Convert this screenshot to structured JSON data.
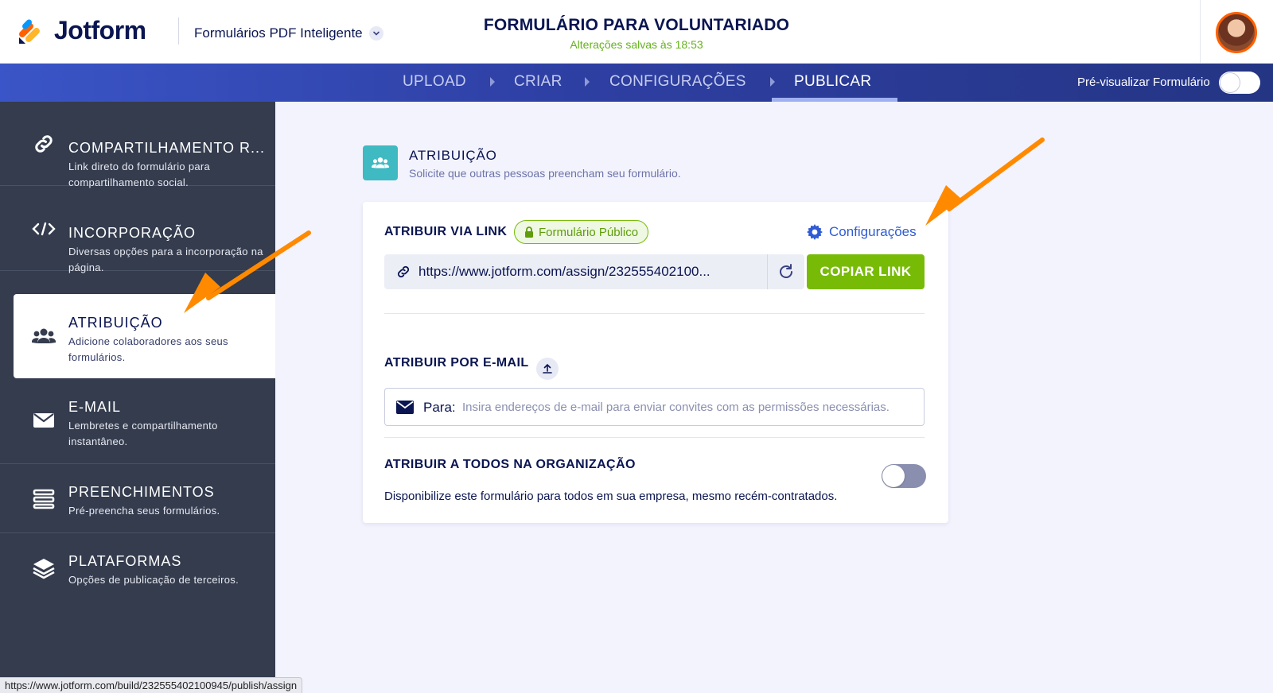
{
  "header": {
    "logo_text": "Jotform",
    "product_name": "Formulários PDF Inteligente",
    "form_title": "FORMULÁRIO PARA VOLUNTARIADO",
    "saved_status": "Alterações salvas às 18:53"
  },
  "nav": {
    "steps": [
      {
        "label": "UPLOAD",
        "active": false
      },
      {
        "label": "CRIAR",
        "active": false
      },
      {
        "label": "CONFIGURAÇÕES",
        "active": false
      },
      {
        "label": "PUBLICAR",
        "active": true
      }
    ],
    "preview_label": "Pré-visualizar Formulário",
    "preview_enabled": false
  },
  "sidebar": {
    "items": [
      {
        "title": "COMPARTILHAMENTO R...",
        "desc": "Link direto do formulário para compartilhamento social.",
        "icon": "link-icon",
        "active": false
      },
      {
        "title": "INCORPORAÇÃO",
        "desc": "Diversas opções para a incorporação na página.",
        "icon": "code-icon",
        "active": false
      },
      {
        "title": "ATRIBUIÇÃO",
        "desc": "Adicione colaboradores aos seus formulários.",
        "icon": "users-icon",
        "active": true
      },
      {
        "title": "E-MAIL",
        "desc": "Lembretes e compartilhamento instantâneo.",
        "icon": "envelope-icon",
        "active": false
      },
      {
        "title": "PREENCHIMENTOS",
        "desc": "Pré-preencha seus formulários.",
        "icon": "list-icon",
        "active": false
      },
      {
        "title": "PLATAFORMAS",
        "desc": "Opções de publicação de terceiros.",
        "icon": "layers-icon",
        "active": false
      }
    ]
  },
  "main": {
    "section_title": "ATRIBUIÇÃO",
    "section_subtitle": "Solicite que outras pessoas preencham seu formulário.",
    "link_section": {
      "label": "ATRIBUIR VIA LINK",
      "badge": "Formulário Público",
      "settings_label": "Configurações",
      "url": "https://www.jotform.com/assign/232555402100...",
      "copy_label": "COPIAR LINK"
    },
    "email_section": {
      "label": "ATRIBUIR POR E-MAIL",
      "to_label": "Para:",
      "placeholder": "Insira endereços de e-mail para enviar convites com as permissões necessárias."
    },
    "org_section": {
      "label": "ATRIBUIR A TODOS NA ORGANIZAÇÃO",
      "desc": "Disponibilize este formulário para todos em sua empresa, mesmo recém-contratados.",
      "enabled": false
    }
  },
  "status_bar": {
    "url": "https://www.jotform.com/build/232555402100945/publish/assign"
  },
  "colors": {
    "brand_navy": "#0a1551",
    "nav_blue": "#2e3fa3",
    "sidebar_bg": "#343c4e",
    "accent_green": "#78bb07",
    "link_blue": "#2f5bd4",
    "teal": "#3fbac2",
    "arrow_orange": "#ff8a00"
  }
}
